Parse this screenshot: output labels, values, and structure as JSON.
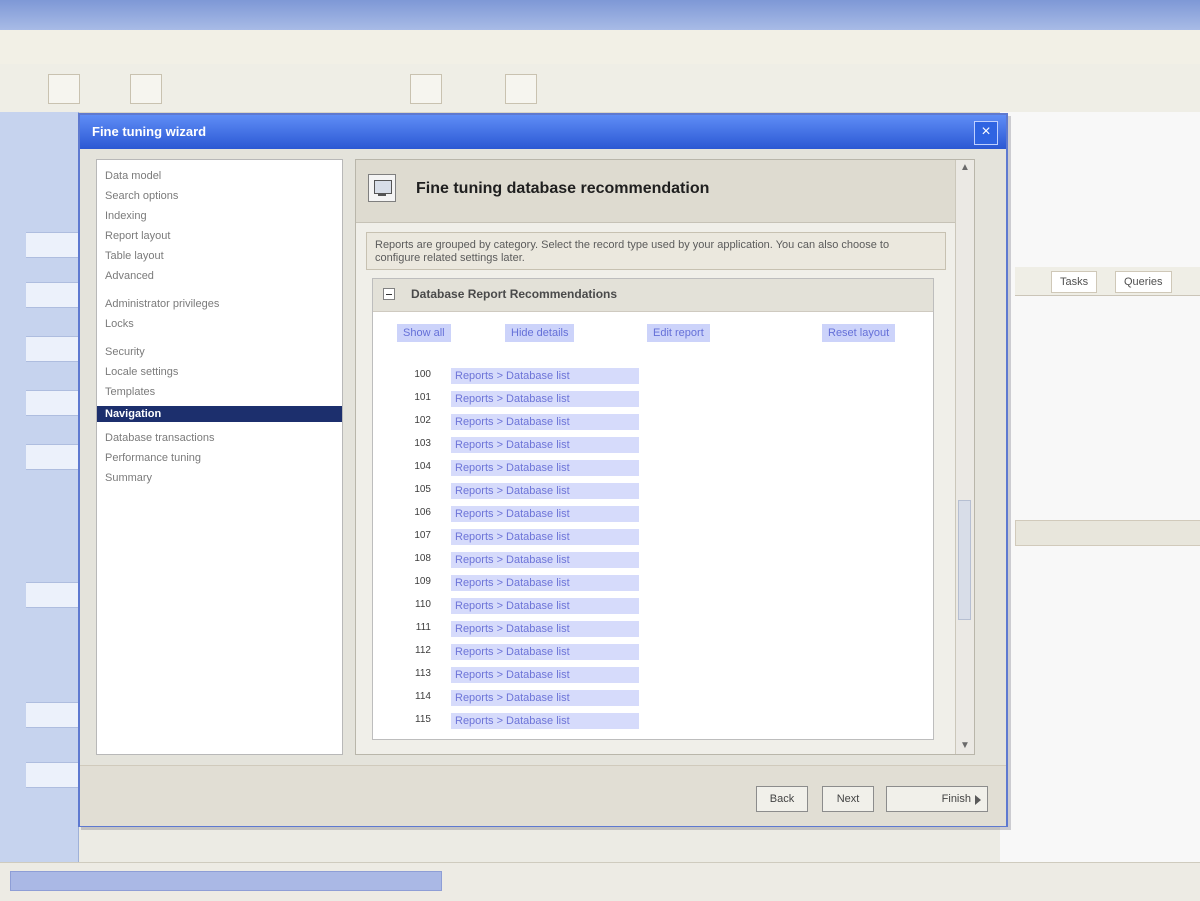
{
  "dialog": {
    "title": "Fine tuning wizard"
  },
  "nav": {
    "items": [
      "Data model",
      "Search options",
      "Indexing",
      "Report layout",
      "Table layout",
      "Advanced",
      "Administrator privileges",
      "Locks",
      "Security",
      "Locale settings",
      "Templates",
      "Navigation",
      "Database transactions",
      "Performance tuning",
      "Summary"
    ],
    "selected_index": 11
  },
  "content": {
    "title": "Fine tuning database recommendation",
    "description": "Reports are grouped by category. Select the record type used by your application. You can also choose to configure related settings later.",
    "panel_title": "Database Report Recommendations",
    "top_links": [
      "Show all",
      "Hide details",
      "Edit report",
      "Reset layout"
    ],
    "rows": [
      {
        "label": "100",
        "link": "Reports > Database list"
      },
      {
        "label": "101",
        "link": "Reports > Database list"
      },
      {
        "label": "102",
        "link": "Reports > Database list"
      },
      {
        "label": "103",
        "link": "Reports > Database list"
      },
      {
        "label": "104",
        "link": "Reports > Database list"
      },
      {
        "label": "105",
        "link": "Reports > Database list"
      },
      {
        "label": "106",
        "link": "Reports > Database list"
      },
      {
        "label": "107",
        "link": "Reports > Database list"
      },
      {
        "label": "108",
        "link": "Reports > Database list"
      },
      {
        "label": "109",
        "link": "Reports > Database list"
      },
      {
        "label": "110",
        "link": "Reports > Database list"
      },
      {
        "label": "111",
        "link": "Reports > Database list"
      },
      {
        "label": "112",
        "link": "Reports > Database list"
      },
      {
        "label": "113",
        "link": "Reports > Database list"
      },
      {
        "label": "114",
        "link": "Reports > Database list"
      },
      {
        "label": "115",
        "link": "Reports > Database list"
      }
    ]
  },
  "footer": {
    "back_label": "Back",
    "next_label": "Next",
    "finish_label": "Finish"
  },
  "background": {
    "tabs": [
      "Tasks",
      "Queries"
    ]
  }
}
